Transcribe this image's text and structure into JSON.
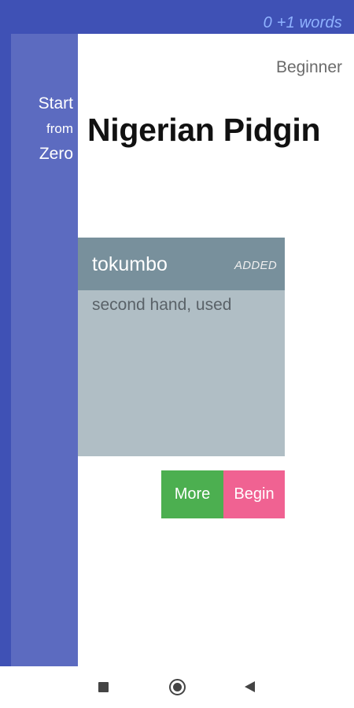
{
  "status_bar": {
    "words_counter": "0  +1 words"
  },
  "sidebar": {
    "start": "Start",
    "from": "from",
    "zero": "Zero"
  },
  "header": {
    "level": "Beginner",
    "language": "Nigerian Pidgin"
  },
  "card": {
    "word": "tokumbo",
    "status": "ADDED",
    "meaning": "second hand, used"
  },
  "actions": {
    "more_label": "More",
    "begin_label": "Begin"
  },
  "nav_bar": {
    "icons": [
      "recents-icon",
      "home-icon",
      "back-icon"
    ]
  },
  "colors": {
    "primary": "#3f51b5",
    "sidebar": "#5c6bc0",
    "card_header": "#78909c",
    "card_body": "#b0bec5",
    "more_button": "#4caf50",
    "begin_button": "#f06292"
  }
}
